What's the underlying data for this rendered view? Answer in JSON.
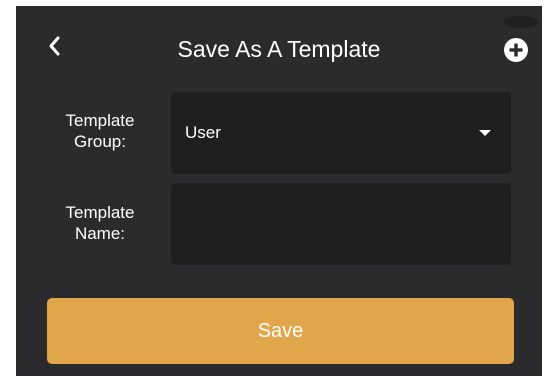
{
  "header": {
    "title": "Save As A Template",
    "back_icon": "chevron-left-icon",
    "add_icon": "plus-circle-icon"
  },
  "form": {
    "group": {
      "label": "Template Group:",
      "value": "User",
      "icon": "caret-down-icon"
    },
    "name": {
      "label": "Template Name:",
      "value": ""
    }
  },
  "actions": {
    "save_label": "Save"
  },
  "colors": {
    "background": "#2b2b2d",
    "field": "#1f1f20",
    "accent": "#e2a64a",
    "text": "#ffffff"
  }
}
